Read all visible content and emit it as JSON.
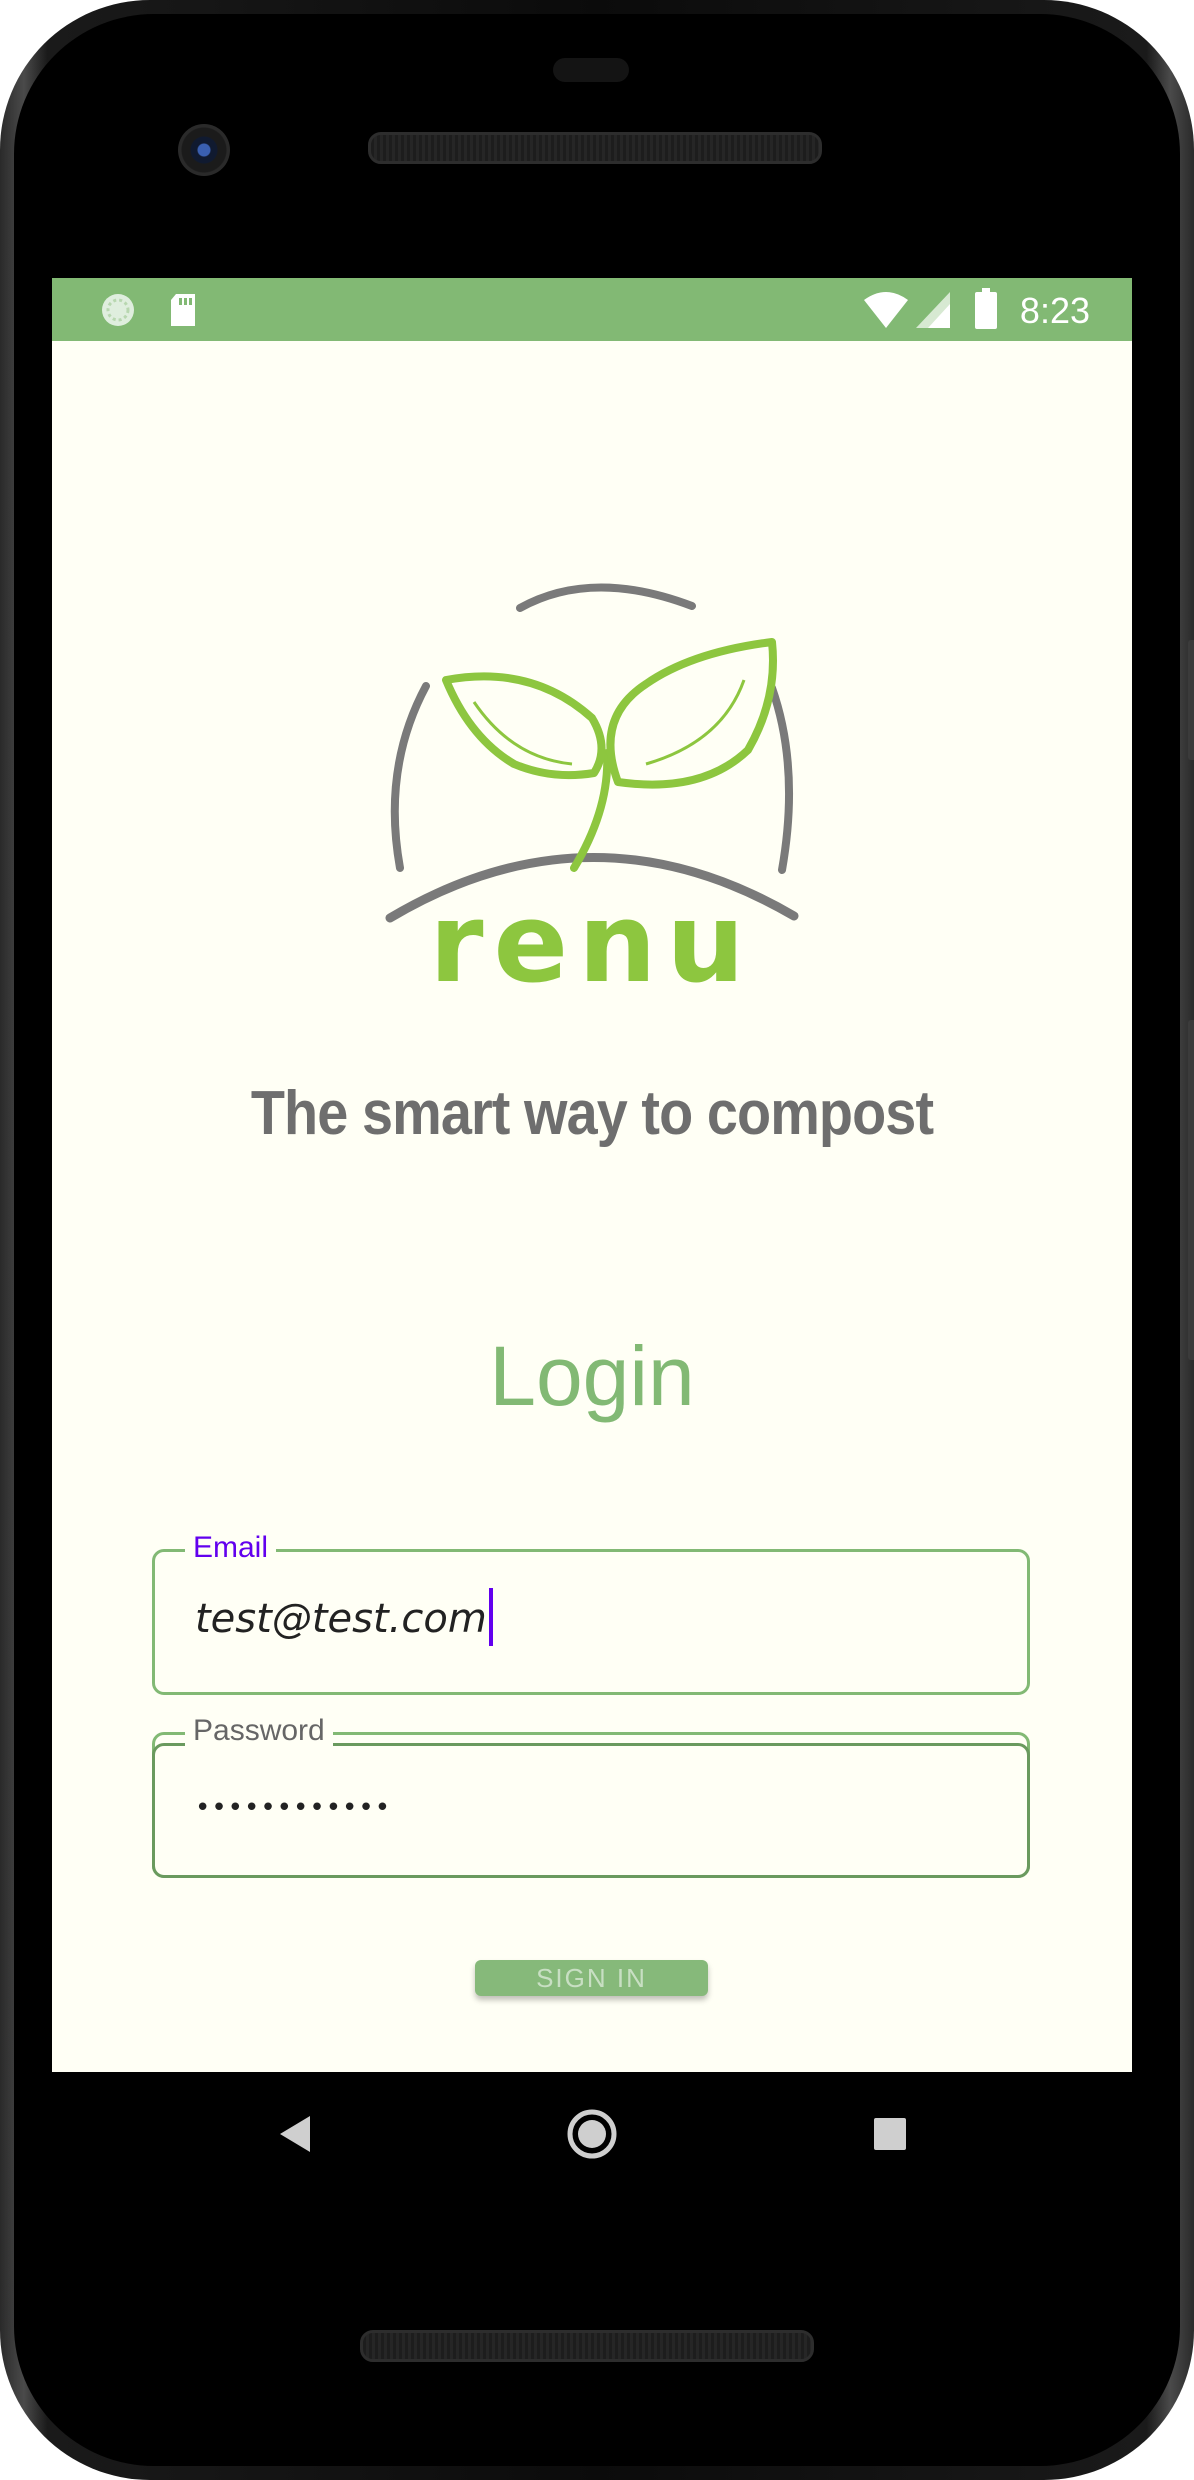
{
  "status_bar": {
    "time": "8:23",
    "left_icons": [
      "sync-icon",
      "sd-card-icon"
    ],
    "right_icons": [
      "wifi-icon",
      "signal-icon",
      "battery-icon"
    ],
    "color": "#82b974"
  },
  "logo": {
    "wordmark": "renu",
    "leaf_color": "#8dc63f",
    "arc_color": "#7a7a7a"
  },
  "tagline": "The smart way to compost",
  "login": {
    "title": "Login",
    "email": {
      "label": "Email",
      "value": "test@test.com"
    },
    "password": {
      "label": "Password",
      "value": "••••••••••••"
    },
    "submit_label": "SIGN IN"
  },
  "nav": {
    "icons": [
      "back-icon",
      "home-icon",
      "recents-icon"
    ]
  },
  "colors": {
    "background": "#fffff5",
    "accent": "#82b974",
    "focus": "#6200ee",
    "tagline": "#6e6e6e"
  }
}
